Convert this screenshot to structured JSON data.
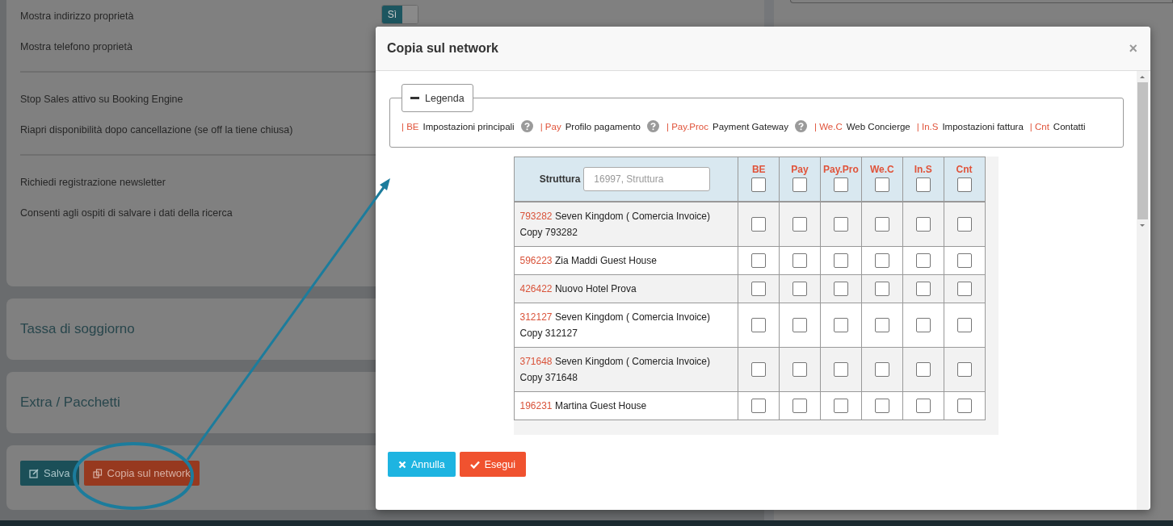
{
  "settings": {
    "rows": [
      {
        "label": "Mostra indirizzo proprietà"
      },
      {
        "label": "Mostra telefono proprietà"
      },
      {
        "kind": "divider"
      },
      {
        "label": "Stop Sales attivo su Booking Engine"
      },
      {
        "label": "Riapri disponibilità dopo cancellazione (se off la tiene chiusa)"
      },
      {
        "kind": "divider"
      },
      {
        "label": "Richiedi registrazione newsletter"
      },
      {
        "label": "Consenti agli ospiti di salvare i dati della ricerca"
      }
    ],
    "toggle": {
      "label": "Sì",
      "on": true
    }
  },
  "sections": [
    {
      "title": "Tassa di soggiorno"
    },
    {
      "title": "Extra / Pacchetti"
    }
  ],
  "actions": [
    {
      "label": "Salva",
      "kind": "save"
    },
    {
      "label": "Copia sul network",
      "kind": "copy"
    }
  ],
  "modal": {
    "title": "Copia sul network",
    "close": "×",
    "legend": {
      "label": "Legenda",
      "expanded": true,
      "items": [
        {
          "code": "| BE",
          "label": "Impostazioni principali",
          "help": true
        },
        {
          "code": "| Pay",
          "label": "Profilo pagamento",
          "help": true
        },
        {
          "code": "| Pay.Proc",
          "label": "Payment Gateway",
          "help": true
        },
        {
          "code": "| We.C",
          "label": "Web Concierge",
          "help": false
        },
        {
          "code": "| In.S",
          "label": "Impostazioni fattura",
          "help": false
        },
        {
          "code": "| Cnt",
          "label": "Contatti",
          "help": false
        }
      ]
    },
    "table": {
      "name_column": "Struttura",
      "search": {
        "placeholder": "16997, Struttura"
      },
      "columns": [
        {
          "label": "BE",
          "checked": false
        },
        {
          "label": "Pay",
          "checked": false
        },
        {
          "label": "Pay.Pro",
          "checked": false
        },
        {
          "label": "We.C",
          "checked": false
        },
        {
          "label": "In.S",
          "checked": false
        },
        {
          "label": "Cnt",
          "checked": false
        }
      ],
      "rows": [
        {
          "id": "793282",
          "name": "Seven Kingdom ( Comercia Invoice) Copy 793282",
          "checks": [
            false,
            false,
            false,
            false,
            false,
            false
          ]
        },
        {
          "id": "596223",
          "name": "Zia Maddi Guest House",
          "checks": [
            false,
            false,
            false,
            false,
            false,
            false
          ]
        },
        {
          "id": "426422",
          "name": "Nuovo Hotel Prova",
          "checks": [
            false,
            false,
            false,
            false,
            false,
            false
          ]
        },
        {
          "id": "312127",
          "name": "Seven Kingdom ( Comercia Invoice) Copy 312127",
          "checks": [
            false,
            false,
            false,
            false,
            false,
            false
          ]
        },
        {
          "id": "371648",
          "name": "Seven Kingdom ( Comercia Invoice) Copy 371648",
          "checks": [
            false,
            false,
            false,
            false,
            false,
            false
          ]
        },
        {
          "id": "196231",
          "name": "Martina Guest House",
          "checks": [
            false,
            false,
            false,
            false,
            false,
            false
          ]
        }
      ]
    },
    "buttons": [
      {
        "label": "Annulla",
        "kind": "cancel"
      },
      {
        "label": "Esegui",
        "kind": "run"
      }
    ]
  }
}
